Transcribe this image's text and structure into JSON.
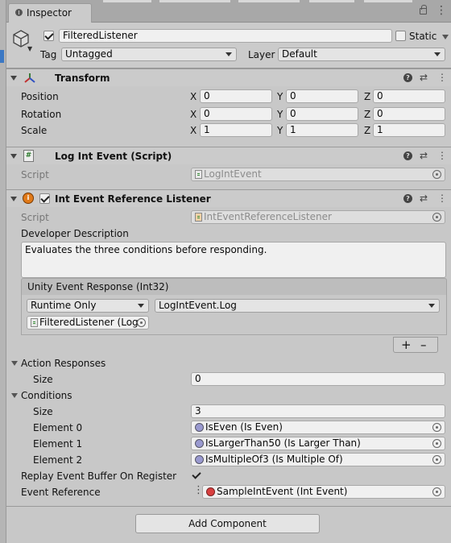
{
  "window": {
    "tab_title": "Inspector"
  },
  "header": {
    "object_name": "FilteredListener",
    "static_label": "Static",
    "tag_label": "Tag",
    "tag_value": "Untagged",
    "layer_label": "Layer",
    "layer_value": "Default"
  },
  "transform": {
    "title": "Transform",
    "rows": [
      {
        "label": "Position",
        "x": "0",
        "y": "0",
        "z": "0"
      },
      {
        "label": "Rotation",
        "x": "0",
        "y": "0",
        "z": "0"
      },
      {
        "label": "Scale",
        "x": "1",
        "y": "1",
        "z": "1"
      }
    ],
    "axis_x": "X",
    "axis_y": "Y",
    "axis_z": "Z"
  },
  "log_script": {
    "title": "Log Int Event (Script)",
    "script_label": "Script",
    "script_value": "LogIntEvent"
  },
  "listener": {
    "title": "Int Event Reference Listener",
    "script_label": "Script",
    "script_value": "IntEventReferenceListener",
    "description_label": "Developer Description",
    "description_value": "Evaluates the three conditions before responding.",
    "unity_event_label": "Unity Event Response (Int32)",
    "runtime_option": "Runtime Only",
    "method_value": "LogIntEvent.Log",
    "target_object": "FilteredListener (Log",
    "add_label": "+",
    "remove_label": "–",
    "action_responses_label": "Action Responses",
    "action_size_label": "Size",
    "action_size_value": "0",
    "conditions_label": "Conditions",
    "conditions_size_label": "Size",
    "conditions_size_value": "3",
    "elements": [
      {
        "label": "Element 0",
        "value": "IsEven (Is Even)"
      },
      {
        "label": "Element 1",
        "value": "IsLargerThan50 (Is Larger Than)"
      },
      {
        "label": "Element 2",
        "value": "IsMultipleOf3 (Is Multiple Of)"
      }
    ],
    "replay_label": "Replay Event Buffer On Register",
    "event_ref_label": "Event Reference",
    "event_ref_value": "SampleIntEvent (Int Event)"
  },
  "footer": {
    "add_component_label": "Add Component"
  }
}
